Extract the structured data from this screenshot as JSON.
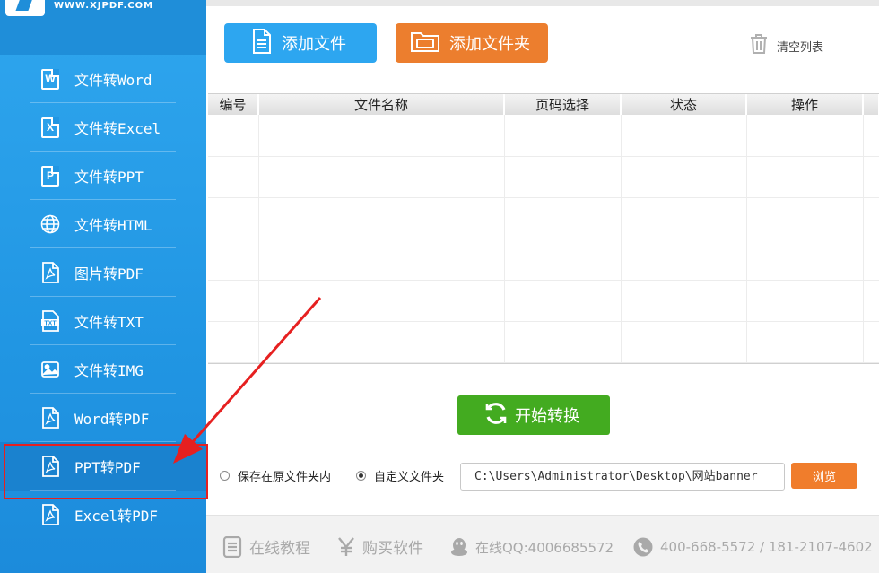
{
  "logo": {
    "url_text": "WWW.XJPDF.COM"
  },
  "sidebar": {
    "items": [
      {
        "label": "文件转Word",
        "icon": "word-doc-icon",
        "badge": "W"
      },
      {
        "label": "文件转Excel",
        "icon": "excel-doc-icon",
        "badge": "X"
      },
      {
        "label": "文件转PPT",
        "icon": "ppt-doc-icon",
        "badge": "P"
      },
      {
        "label": "文件转HTML",
        "icon": "globe-icon"
      },
      {
        "label": "图片转PDF",
        "icon": "pdf-doc-icon"
      },
      {
        "label": "文件转TXT",
        "icon": "txt-doc-icon",
        "badge": "TXT"
      },
      {
        "label": "文件转IMG",
        "icon": "image-icon"
      },
      {
        "label": "Word转PDF",
        "icon": "pdf-doc-icon"
      },
      {
        "label": "PPT转PDF",
        "icon": "pdf-doc-icon",
        "active": true
      },
      {
        "label": "Excel转PDF",
        "icon": "pdf-doc-icon"
      }
    ]
  },
  "toolbar": {
    "add_file_label": "添加文件",
    "add_folder_label": "添加文件夹",
    "clear_list_label": "清空列表"
  },
  "table": {
    "columns": [
      "编号",
      "文件名称",
      "页码选择",
      "状态",
      "操作"
    ],
    "rows": []
  },
  "convert": {
    "start_label": "开始转换"
  },
  "output": {
    "option_original": "保存在原文件夹内",
    "option_custom": "自定义文件夹",
    "selected": "custom",
    "path_value": "C:\\Users\\Administrator\\Desktop\\网站banner",
    "browse_label": "浏览"
  },
  "footer": {
    "tutorial": "在线教程",
    "buy": "购买软件",
    "qq": "在线QQ:4006685572",
    "phone": "400-668-5572 / 181-2107-4602"
  },
  "colors": {
    "sidebar_blue": "#2196e3",
    "add_file_blue": "#2da6f0",
    "add_folder_orange": "#ec7e2e",
    "start_green": "#43ab20",
    "annotation_red": "#e62020"
  }
}
